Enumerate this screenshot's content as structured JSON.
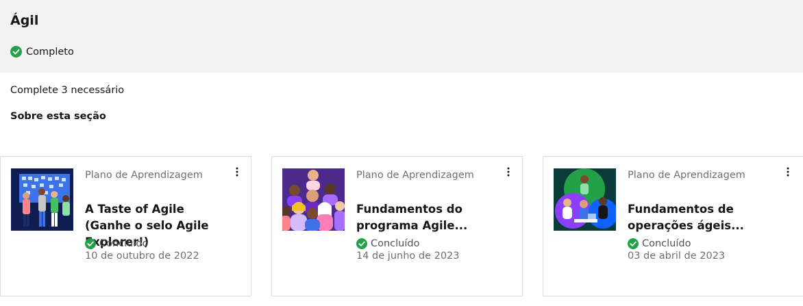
{
  "section": {
    "title": "Ágil",
    "status": "Completo",
    "requirement": "Complete 3 necessário",
    "about_label": "Sobre esta seção",
    "status_color": "#24a148"
  },
  "cards": [
    {
      "type": "Plano de Aprendizagem",
      "title": "A Taste of Agile (Ganhe o selo Agile Explorer!)",
      "status": "Concluído",
      "date": "10 de outubro de 2022",
      "thumbnail_icon": "team-board-illustration"
    },
    {
      "type": "Plano de Aprendizagem",
      "title": "Fundamentos do programa Agile...",
      "status": "Concluído",
      "date": "14 de junho de 2023",
      "thumbnail_icon": "group-of-people-illustration"
    },
    {
      "type": "Plano de Aprendizagem",
      "title": "Fundamentos de operações ágeis...",
      "status": "Concluído",
      "date": "03 de abril de 2023",
      "thumbnail_icon": "team-collaboration-illustration"
    }
  ]
}
